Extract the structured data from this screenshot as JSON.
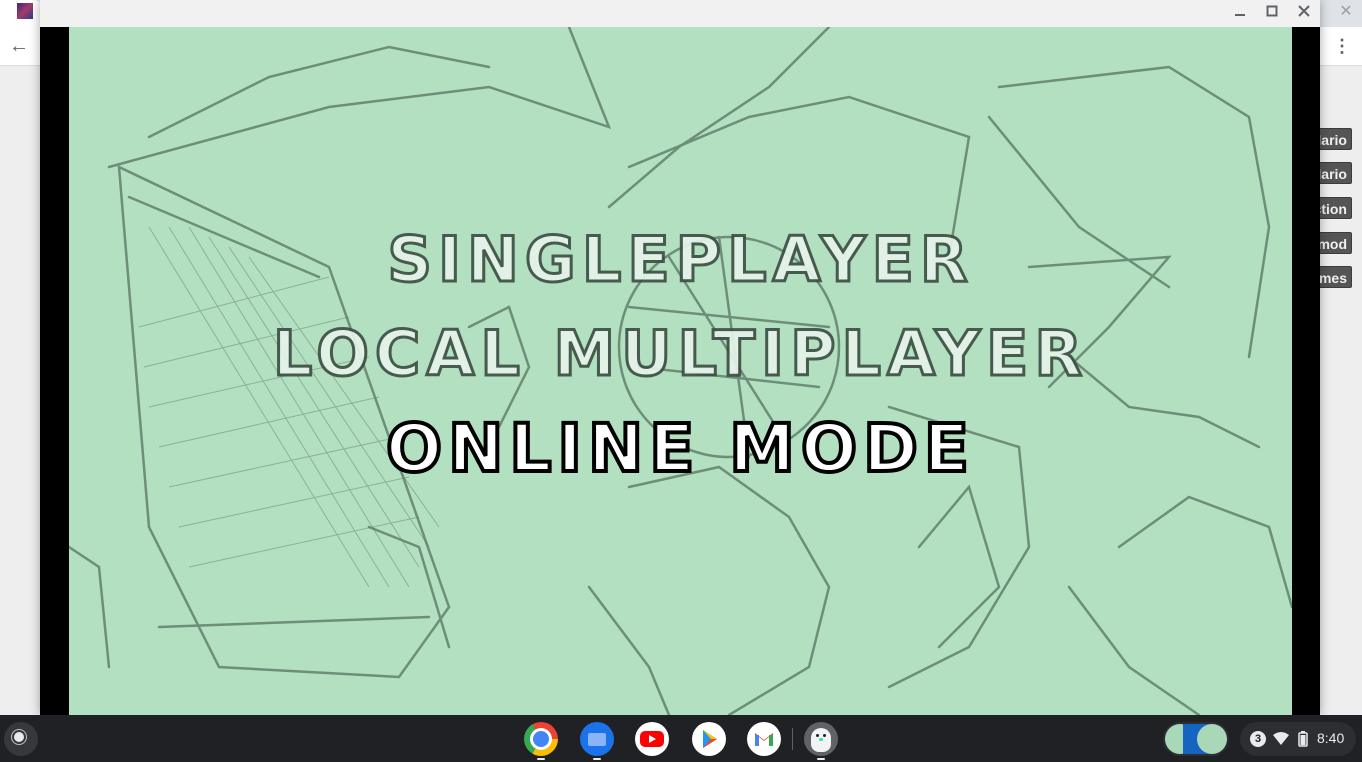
{
  "background_browser": {
    "side_buttons": [
      "lario",
      "lario",
      "ction",
      "mod",
      "ames"
    ],
    "icons": {
      "back": "arrow-left-icon",
      "close_tab": "close-icon",
      "more_menu": "vertical-dots-icon"
    }
  },
  "window": {
    "controls": {
      "minimize": "minimize-icon",
      "maximize": "maximize-icon",
      "close": "close-icon"
    }
  },
  "game": {
    "menu_items": [
      {
        "label": "SINGLEPLAYER",
        "selected": false
      },
      {
        "label": "LOCAL MULTIPLAYER",
        "selected": false
      },
      {
        "label": "ONLINE MODE",
        "selected": true
      }
    ],
    "colors": {
      "background": "#b2e0c0",
      "sketch_lines": "#5d7a68",
      "selected_fill": "#ffffff",
      "selected_outline": "#000000"
    }
  },
  "shelf": {
    "apps": [
      {
        "name": "Chrome",
        "icon": "chrome-icon",
        "running": true
      },
      {
        "name": "Files",
        "icon": "files-icon",
        "running": true
      },
      {
        "name": "YouTube",
        "icon": "youtube-icon",
        "running": false
      },
      {
        "name": "Play Store",
        "icon": "play-store-icon",
        "running": false
      },
      {
        "name": "Gmail",
        "icon": "gmail-icon",
        "running": false
      },
      {
        "name": "Penguin App",
        "icon": "penguin-icon",
        "running": true
      }
    ],
    "notification_count": "3",
    "time": "8:40",
    "status_icons": [
      "wifi-icon",
      "battery-icon"
    ]
  }
}
